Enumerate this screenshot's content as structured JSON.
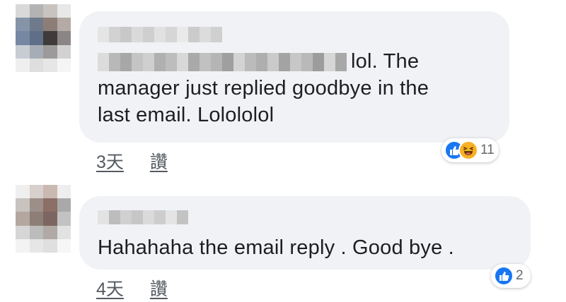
{
  "comments": [
    {
      "author_redacted": true,
      "text": "lol. The manager just replied goodbye in the last email. Lolololol",
      "text_line1": "lol. The",
      "text_line2": "manager just replied goodbye in the",
      "text_line3": "last email. Lolololol",
      "time": "3天",
      "like_label": "讚",
      "reactions": [
        "like-icon",
        "haha-icon"
      ],
      "reaction_count": "11"
    },
    {
      "author_redacted": true,
      "text": "Hahahaha the email reply . Good bye .",
      "time": "4天",
      "like_label": "讚",
      "reactions": [
        "like-icon"
      ],
      "reaction_count": "2"
    }
  ],
  "colors": {
    "bubble": "#f0f2f5",
    "text": "#1c1e21",
    "like_blue": "#1877f2",
    "haha_yellow": "#f7b125"
  }
}
